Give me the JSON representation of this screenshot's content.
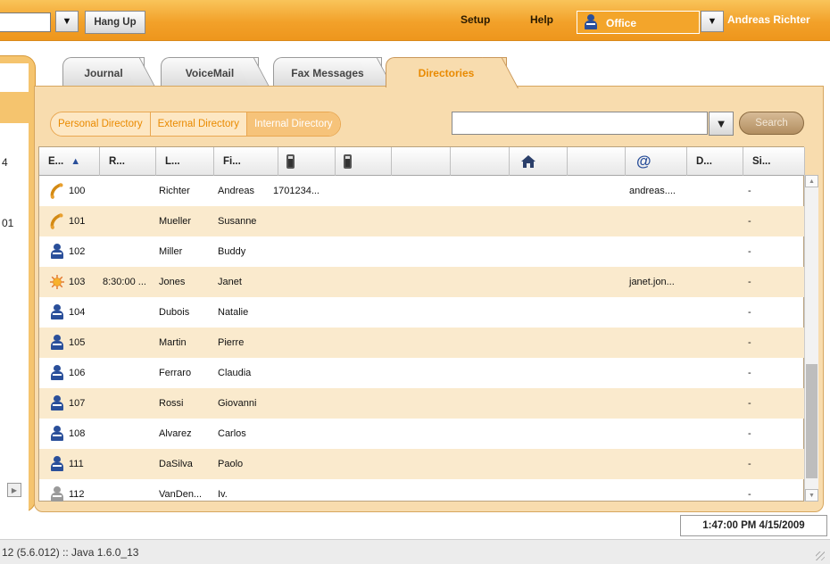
{
  "toolbar": {
    "hang_up_label": "Hang Up",
    "dropdown_glyph": "▼",
    "setup_label": "Setup",
    "help_label": "Help",
    "location_label": "Office",
    "user_name": "Andreas Richter"
  },
  "left_panel": {
    "partial_text_1": "4",
    "partial_text_2": "01"
  },
  "tabs": [
    {
      "label": "Journal",
      "active": false
    },
    {
      "label": "VoiceMail",
      "active": false
    },
    {
      "label": "Fax Messages",
      "active": false
    },
    {
      "label": "Directories",
      "active": true
    }
  ],
  "sub_tabs": [
    {
      "label": "Personal Directory",
      "active": false
    },
    {
      "label": "External Directory",
      "active": false
    },
    {
      "label": "Internal Directory",
      "active": true
    }
  ],
  "search": {
    "value": "",
    "dropdown_glyph": "▼",
    "button_label": "Search"
  },
  "table": {
    "columns": [
      {
        "label": "E...",
        "sorted": "ascending",
        "icon": ""
      },
      {
        "label": "R...",
        "icon": ""
      },
      {
        "label": "L...",
        "icon": ""
      },
      {
        "label": "Fi...",
        "icon": ""
      },
      {
        "label": "",
        "icon": "mobile-phone-icon"
      },
      {
        "label": "",
        "icon": "mobile-phone-icon"
      },
      {
        "label": "",
        "icon": ""
      },
      {
        "label": "",
        "icon": ""
      },
      {
        "label": "",
        "icon": "home-icon"
      },
      {
        "label": "",
        "icon": ""
      },
      {
        "label": "",
        "icon": "email-at-icon"
      },
      {
        "label": "D...",
        "icon": ""
      },
      {
        "label": "Si...",
        "icon": ""
      }
    ],
    "sort_glyph": "▲",
    "at_glyph": "@",
    "rows": [
      {
        "status": "on-phone",
        "ext": "100",
        "r": "",
        "last": "Richter",
        "first": "Andreas",
        "phone": "1701234...",
        "email": "andreas....",
        "si": "-"
      },
      {
        "status": "on-phone",
        "ext": "101",
        "r": "",
        "last": "Mueller",
        "first": "Susanne",
        "phone": "",
        "email": "",
        "si": "-"
      },
      {
        "status": "available",
        "ext": "102",
        "r": "",
        "last": "Miller",
        "first": "Buddy",
        "phone": "",
        "email": "",
        "si": "-"
      },
      {
        "status": "away",
        "ext": "103",
        "r": "8:30:00 ...",
        "last": "Jones",
        "first": "Janet",
        "phone": "",
        "email": "janet.jon...",
        "si": "-"
      },
      {
        "status": "available",
        "ext": "104",
        "r": "",
        "last": "Dubois",
        "first": "Natalie",
        "phone": "",
        "email": "",
        "si": "-"
      },
      {
        "status": "available",
        "ext": "105",
        "r": "",
        "last": "Martin",
        "first": "Pierre",
        "phone": "",
        "email": "",
        "si": "-"
      },
      {
        "status": "available",
        "ext": "106",
        "r": "",
        "last": "Ferraro",
        "first": "Claudia",
        "phone": "",
        "email": "",
        "si": "-"
      },
      {
        "status": "available",
        "ext": "107",
        "r": "",
        "last": "Rossi",
        "first": "Giovanni",
        "phone": "",
        "email": "",
        "si": "-"
      },
      {
        "status": "available",
        "ext": "108",
        "r": "",
        "last": "Alvarez",
        "first": "Carlos",
        "phone": "",
        "email": "",
        "si": "-"
      },
      {
        "status": "available",
        "ext": "111",
        "r": "",
        "last": "DaSilva",
        "first": "Paolo",
        "phone": "",
        "email": "",
        "si": "-"
      },
      {
        "status": "offline",
        "ext": "112",
        "r": "",
        "last": "VanDen...",
        "first": "Iv.",
        "phone": "",
        "email": "",
        "si": "-"
      }
    ]
  },
  "clock": "1:47:00 PM 4/15/2009",
  "status_bar": "12 (5.6.012) :: Java 1.6.0_13",
  "colors": {
    "accent_orange": "#f2a12a",
    "panel_bg": "#f8dcae",
    "row_alt": "#faeacd",
    "person_blue": "#2a4f9a",
    "person_gray": "#9a9a9a",
    "active_tab_text": "#e98a00"
  }
}
